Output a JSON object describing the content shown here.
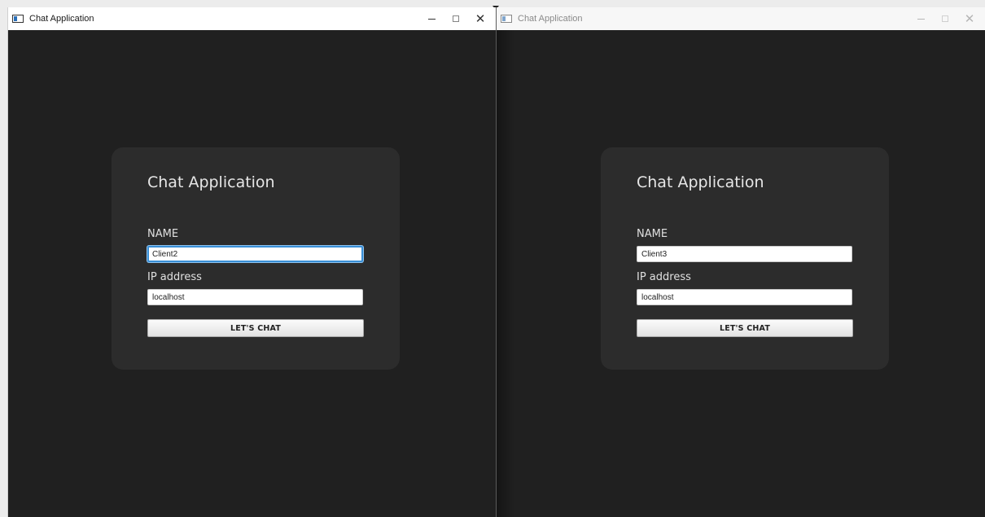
{
  "windows": [
    {
      "title": "Chat Application",
      "app_icon": "window-app-icon",
      "state": "active",
      "controls": {
        "minimize": "minimize-icon",
        "maximize": "maximize-icon",
        "close_glyph": "✕"
      },
      "form": {
        "heading": "Chat Application",
        "name_label": "NAME",
        "name_value": "Client2",
        "ip_label": "IP address",
        "ip_value": "localhost",
        "submit_label": "LET'S CHAT"
      }
    },
    {
      "title": "Chat Application",
      "app_icon": "window-app-icon",
      "state": "inactive",
      "controls": {
        "minimize": "minimize-icon",
        "maximize": "maximize-icon",
        "close_glyph": "✕"
      },
      "form": {
        "heading": "Chat Application",
        "name_label": "NAME",
        "name_value": "Client3",
        "ip_label": "IP address",
        "ip_value": "localhost",
        "submit_label": "LET'S CHAT"
      }
    }
  ],
  "colors": {
    "window_background": "#202020",
    "card_background": "#2c2c2c",
    "focus_ring": "#3a8fd6"
  }
}
